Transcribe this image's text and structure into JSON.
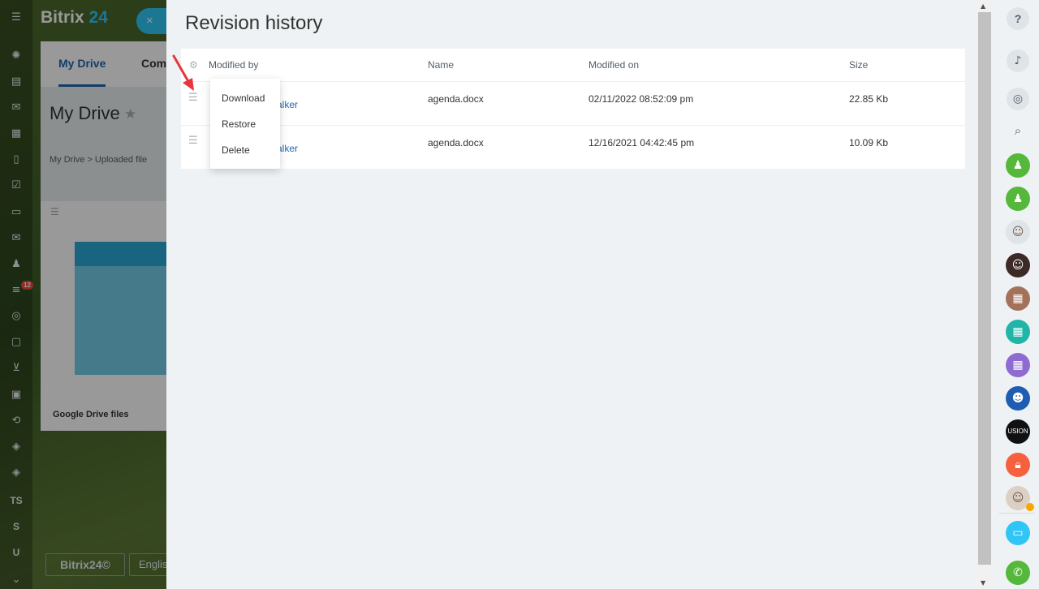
{
  "app": {
    "brand_name": "Bitrix",
    "brand_number": "24",
    "close_label": "×",
    "tabs": [
      "My Drive",
      "Comp"
    ],
    "page_title": "My Drive",
    "breadcrumb": "My Drive  >  Uploaded file",
    "card_label": "Google Drive files",
    "footer_logo": "Bitrix24©",
    "footer_lang": "Englis",
    "left_rail": {
      "badge": "12",
      "text_items": [
        "TS",
        "S",
        "U"
      ]
    }
  },
  "slider": {
    "title": "Revision history",
    "columns": {
      "modified_by": "Modified by",
      "name": "Name",
      "modified_on": "Modified on",
      "size": "Size"
    },
    "rows": [
      {
        "modified_by": "alker",
        "name": "agenda.docx",
        "modified_on": "02/11/2022 08:52:09 pm",
        "size": "22.85 Kb"
      },
      {
        "modified_by": "alker",
        "name": "agenda.docx",
        "modified_on": "12/16/2021 04:42:45 pm",
        "size": "10.09 Kb"
      }
    ],
    "context_menu": [
      "Download",
      "Restore",
      "Delete"
    ]
  },
  "right_bar": {
    "help_label": "?",
    "fusion_label": "USION"
  },
  "colors": {
    "accent": "#2fc6f6",
    "link": "#2067b0",
    "annotation": "#e8343c",
    "green": "#55b83a",
    "orange": "#f5603f"
  }
}
